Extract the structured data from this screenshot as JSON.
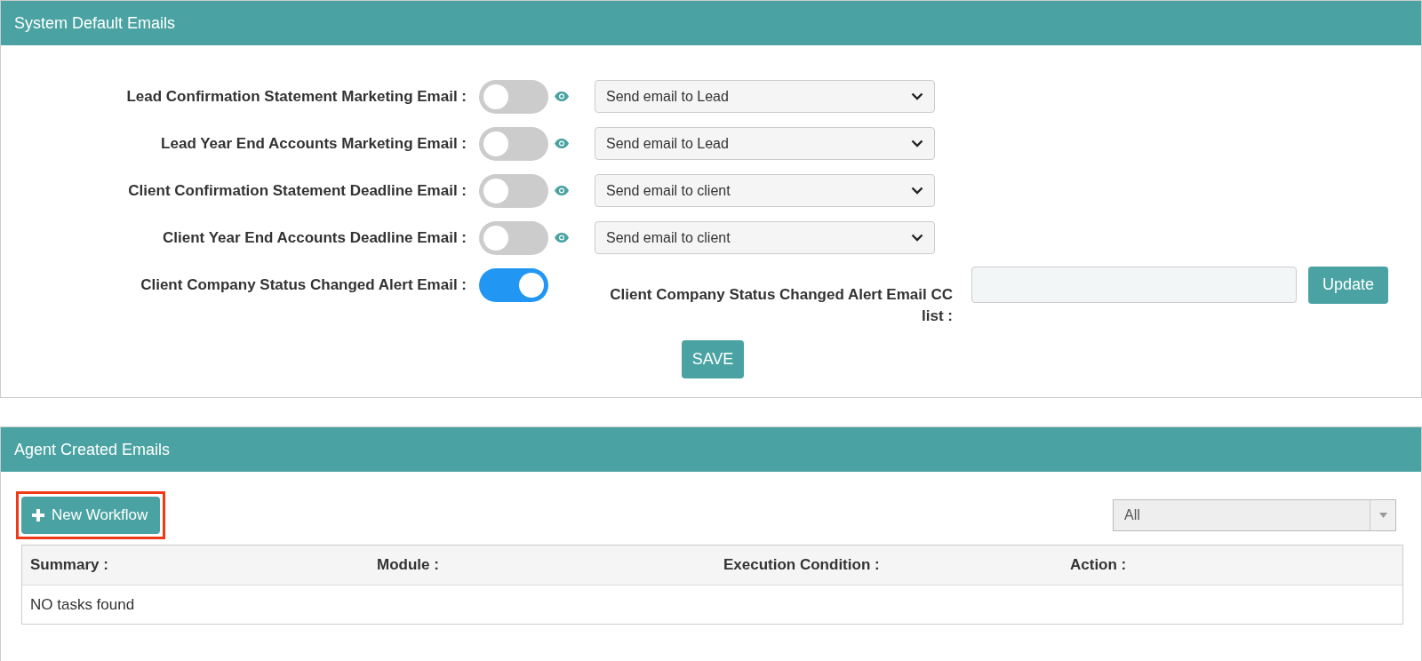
{
  "system_panel": {
    "title": "System Default Emails",
    "settings": [
      {
        "kind": "toggle_select",
        "label": "Lead Confirmation Statement Marketing Email :",
        "on": false,
        "recipient": "Send email to Lead"
      },
      {
        "kind": "toggle_select",
        "label": "Lead Year End Accounts Marketing Email :",
        "on": false,
        "recipient": "Send email to Lead"
      },
      {
        "kind": "toggle_select",
        "label": "Client Confirmation Statement Deadline Email :",
        "on": false,
        "recipient": "Send email to client"
      },
      {
        "kind": "toggle_select",
        "label": "Client Year End Accounts Deadline Email :",
        "on": false,
        "recipient": "Send email to client"
      },
      {
        "kind": "toggle_cc",
        "label": "Client Company Status Changed Alert Email :",
        "on": true,
        "cc_label": "Client Company Status Changed Alert Email CC list :",
        "button": "Update"
      }
    ],
    "save_button": "SAVE"
  },
  "agent_panel": {
    "title": "Agent Created Emails",
    "new_button": {
      "label": "New Workflow",
      "highlighted": true
    },
    "filter": {
      "value": "All"
    },
    "table": {
      "columns": [
        "Summary :",
        "Module :",
        "Execution Condition :",
        "Action :"
      ],
      "empty_message": "NO tasks found"
    }
  }
}
